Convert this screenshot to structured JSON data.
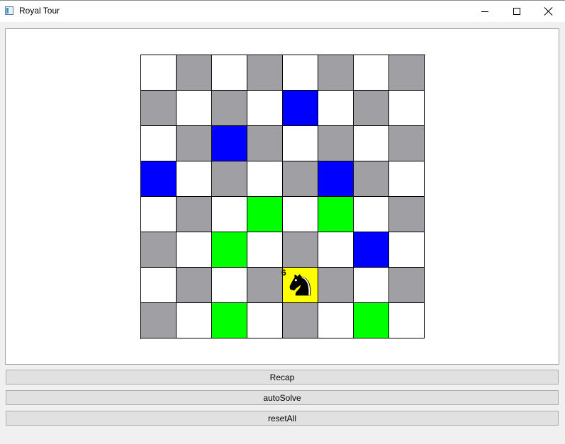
{
  "window": {
    "title": "Royal Tour",
    "app_icon": "window-app-icon",
    "controls": [
      "minimize-icon",
      "maximize-icon",
      "close-icon"
    ]
  },
  "colors": {
    "light": "#ffffff",
    "dark": "#a0a0a4",
    "blue": "#0000ff",
    "green": "#00ff00",
    "yellow": "#ffff00",
    "grid_line": "#000000"
  },
  "board": {
    "rows": [
      [
        "light",
        "dark",
        "light",
        "dark",
        "light",
        "dark",
        "light",
        "dark"
      ],
      [
        "dark",
        "light",
        "dark",
        "light",
        "blue",
        "light",
        "dark",
        "light"
      ],
      [
        "light",
        "dark",
        "blue",
        "dark",
        "light",
        "dark",
        "light",
        "dark"
      ],
      [
        "blue",
        "light",
        "dark",
        "light",
        "dark",
        "blue",
        "dark",
        "light"
      ],
      [
        "light",
        "dark",
        "light",
        "green",
        "light",
        "green",
        "light",
        "dark"
      ],
      [
        "dark",
        "light",
        "green",
        "light",
        "dark",
        "light",
        "blue",
        "light"
      ],
      [
        "light",
        "dark",
        "light",
        "dark",
        "yellow",
        "dark",
        "light",
        "dark"
      ],
      [
        "dark",
        "light",
        "green",
        "light",
        "dark",
        "light",
        "green",
        "light"
      ]
    ],
    "knight": {
      "row": 6,
      "col": 4,
      "icon": "knight-icon",
      "move_label": "6"
    }
  },
  "buttons": {
    "recap": "Recap",
    "autosolve": "autoSolve",
    "reset": "resetAll"
  }
}
